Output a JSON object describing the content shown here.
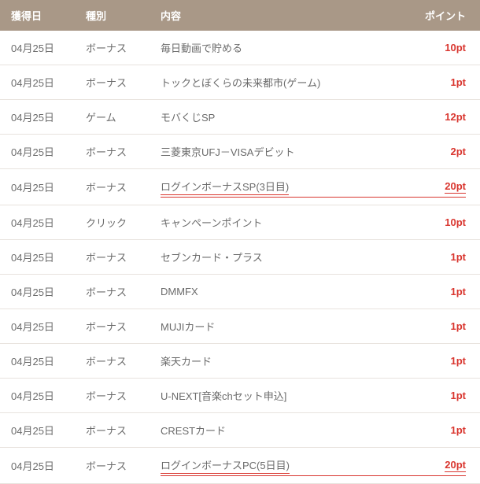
{
  "headers": {
    "date": "獲得日",
    "kind": "種別",
    "desc": "内容",
    "points": "ポイント"
  },
  "rows": [
    {
      "date": "04月25日",
      "kind": "ボーナス",
      "desc": "毎日動画で貯める",
      "points": "10pt",
      "highlight": false
    },
    {
      "date": "04月25日",
      "kind": "ボーナス",
      "desc": "トックとぼくらの未来都市(ゲーム)",
      "points": "1pt",
      "highlight": false
    },
    {
      "date": "04月25日",
      "kind": "ゲーム",
      "desc": "モバくじSP",
      "points": "12pt",
      "highlight": false
    },
    {
      "date": "04月25日",
      "kind": "ボーナス",
      "desc": "三菱東京UFJ－VISAデビット",
      "points": "2pt",
      "highlight": false
    },
    {
      "date": "04月25日",
      "kind": "ボーナス",
      "desc": "ログインボーナスSP(3日目)",
      "points": "20pt",
      "highlight": true
    },
    {
      "date": "04月25日",
      "kind": "クリック",
      "desc": "キャンペーンポイント",
      "points": "10pt",
      "highlight": false
    },
    {
      "date": "04月25日",
      "kind": "ボーナス",
      "desc": "セブンカード・プラス",
      "points": "1pt",
      "highlight": false
    },
    {
      "date": "04月25日",
      "kind": "ボーナス",
      "desc": "DMMFX",
      "points": "1pt",
      "highlight": false
    },
    {
      "date": "04月25日",
      "kind": "ボーナス",
      "desc": "MUJIカード",
      "points": "1pt",
      "highlight": false
    },
    {
      "date": "04月25日",
      "kind": "ボーナス",
      "desc": "楽天カード",
      "points": "1pt",
      "highlight": false
    },
    {
      "date": "04月25日",
      "kind": "ボーナス",
      "desc": "U-NEXT[音楽chセット申込]",
      "points": "1pt",
      "highlight": false
    },
    {
      "date": "04月25日",
      "kind": "ボーナス",
      "desc": "CRESTカード",
      "points": "1pt",
      "highlight": false
    },
    {
      "date": "04月25日",
      "kind": "ボーナス",
      "desc": "ログインボーナスPC(5日目)",
      "points": "20pt",
      "highlight": true
    }
  ]
}
